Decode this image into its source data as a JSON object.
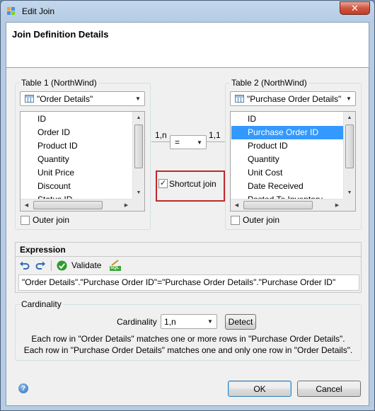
{
  "window": {
    "title": "Edit Join",
    "close_glyph": "✕"
  },
  "header": {
    "title": "Join Definition Details"
  },
  "table1": {
    "group_label": "Table 1 (NorthWind)",
    "selected_table": "\"Order Details\"",
    "columns": [
      "ID",
      "Order ID",
      "Product ID",
      "Quantity",
      "Unit Price",
      "Discount",
      "Status ID"
    ],
    "outer_join_label": "Outer join",
    "outer_join_checked": false
  },
  "table2": {
    "group_label": "Table 2 (NorthWind)",
    "selected_table": "\"Purchase Order Details\"",
    "columns": [
      "ID",
      "Purchase Order ID",
      "Product ID",
      "Quantity",
      "Unit Cost",
      "Date Received",
      "Posted To Inventory"
    ],
    "selected_column": "Purchase Order ID",
    "outer_join_label": "Outer join",
    "outer_join_checked": false
  },
  "join": {
    "left_cardinality": "1,n",
    "operator": "=",
    "right_cardinality": "1,1",
    "shortcut_join_label": "Shortcut join",
    "shortcut_join_checked": true,
    "check_glyph": "✓"
  },
  "expression": {
    "heading": "Expression",
    "validate_label": "Validate",
    "sql_label": "SQL",
    "text": "\"Order Details\".\"Purchase Order ID\"=\"Purchase Order Details\".\"Purchase Order ID\""
  },
  "cardinality": {
    "group_label": "Cardinality",
    "field_label": "Cardinality",
    "value": "1,n",
    "detect_label": "Detect",
    "description_line1": "Each row in \"Order Details\" matches one or more rows in \"Purchase Order Details\".",
    "description_line2": "Each row in \"Purchase Order Details\" matches one and only one row in \"Order Details\"."
  },
  "footer": {
    "ok_label": "OK",
    "cancel_label": "Cancel",
    "help_glyph": "?"
  },
  "icons": [
    "app-icon",
    "close-icon",
    "table-icon",
    "chevron-down-icon",
    "undo-icon",
    "redo-icon",
    "validate-check-icon",
    "sql-icon",
    "help-icon"
  ]
}
